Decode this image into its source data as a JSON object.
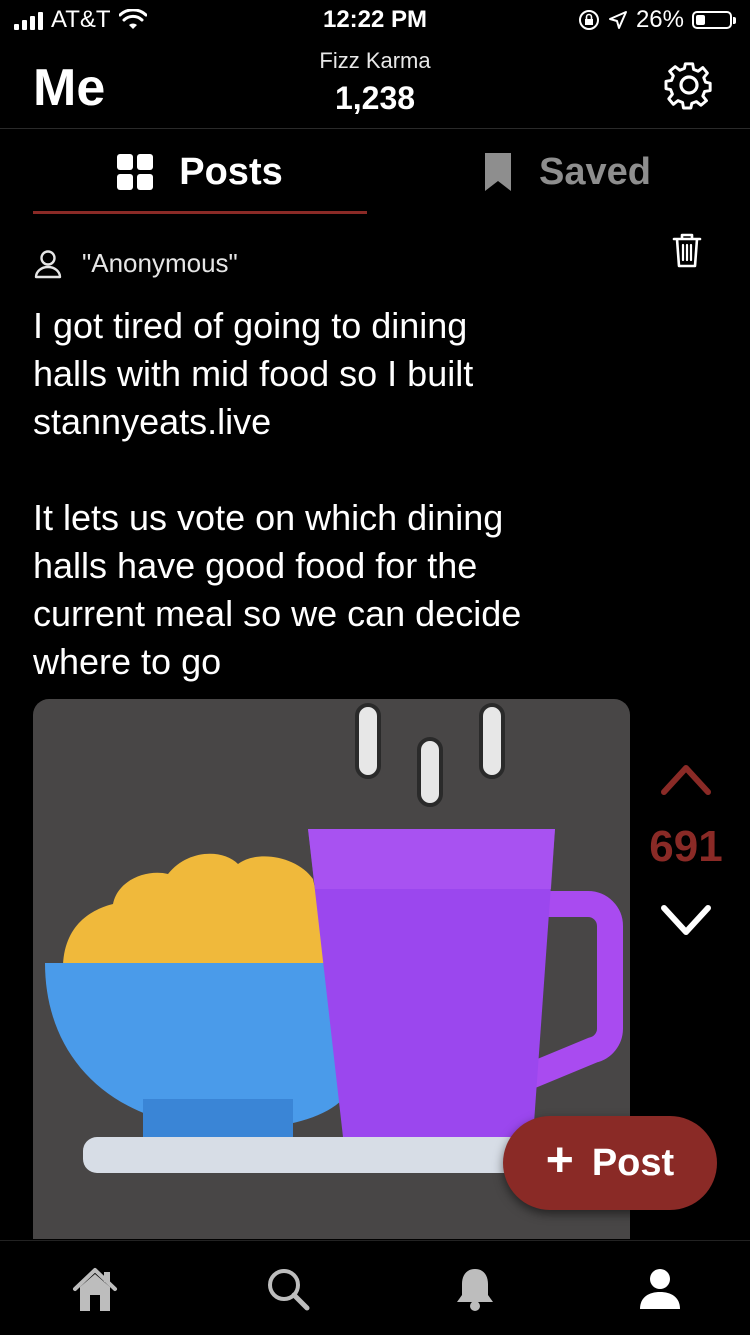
{
  "status_bar": {
    "carrier": "AT&T",
    "time": "12:22 PM",
    "battery": "26%",
    "icons": [
      "signal-icon",
      "wifi-icon",
      "orientation-lock-icon",
      "location-icon",
      "battery-icon"
    ]
  },
  "header": {
    "title": "Me",
    "karma_label": "Fizz Karma",
    "karma_value": "1,238",
    "settings_icon": "gear-icon"
  },
  "tabs": [
    {
      "label": "Posts",
      "icon": "grid-icon",
      "active": true
    },
    {
      "label": "Saved",
      "icon": "bookmark-icon",
      "active": false
    }
  ],
  "post": {
    "author": "\"Anonymous\"",
    "body": "I got tired of going to dining\nhalls with mid food so I built\nstannyeats.live\n\nIt lets us vote on which dining\nhalls have good food for the\ncurrent meal so we can decide\nwhere to go",
    "image_icon": "bowl-and-cup-illustration",
    "votes": "691",
    "delete_icon": "trash-icon"
  },
  "fab": {
    "label": "Post",
    "icon": "plus-icon"
  },
  "bottom_nav": [
    {
      "name": "home",
      "icon": "home-icon"
    },
    {
      "name": "search",
      "icon": "search-icon"
    },
    {
      "name": "notifications",
      "icon": "bell-icon"
    },
    {
      "name": "profile",
      "icon": "person-icon",
      "active": true
    }
  ],
  "colors": {
    "accent": "#8a2a26",
    "background": "#000000",
    "inactive": "#8e8e8e",
    "image_bg": "#484646"
  }
}
